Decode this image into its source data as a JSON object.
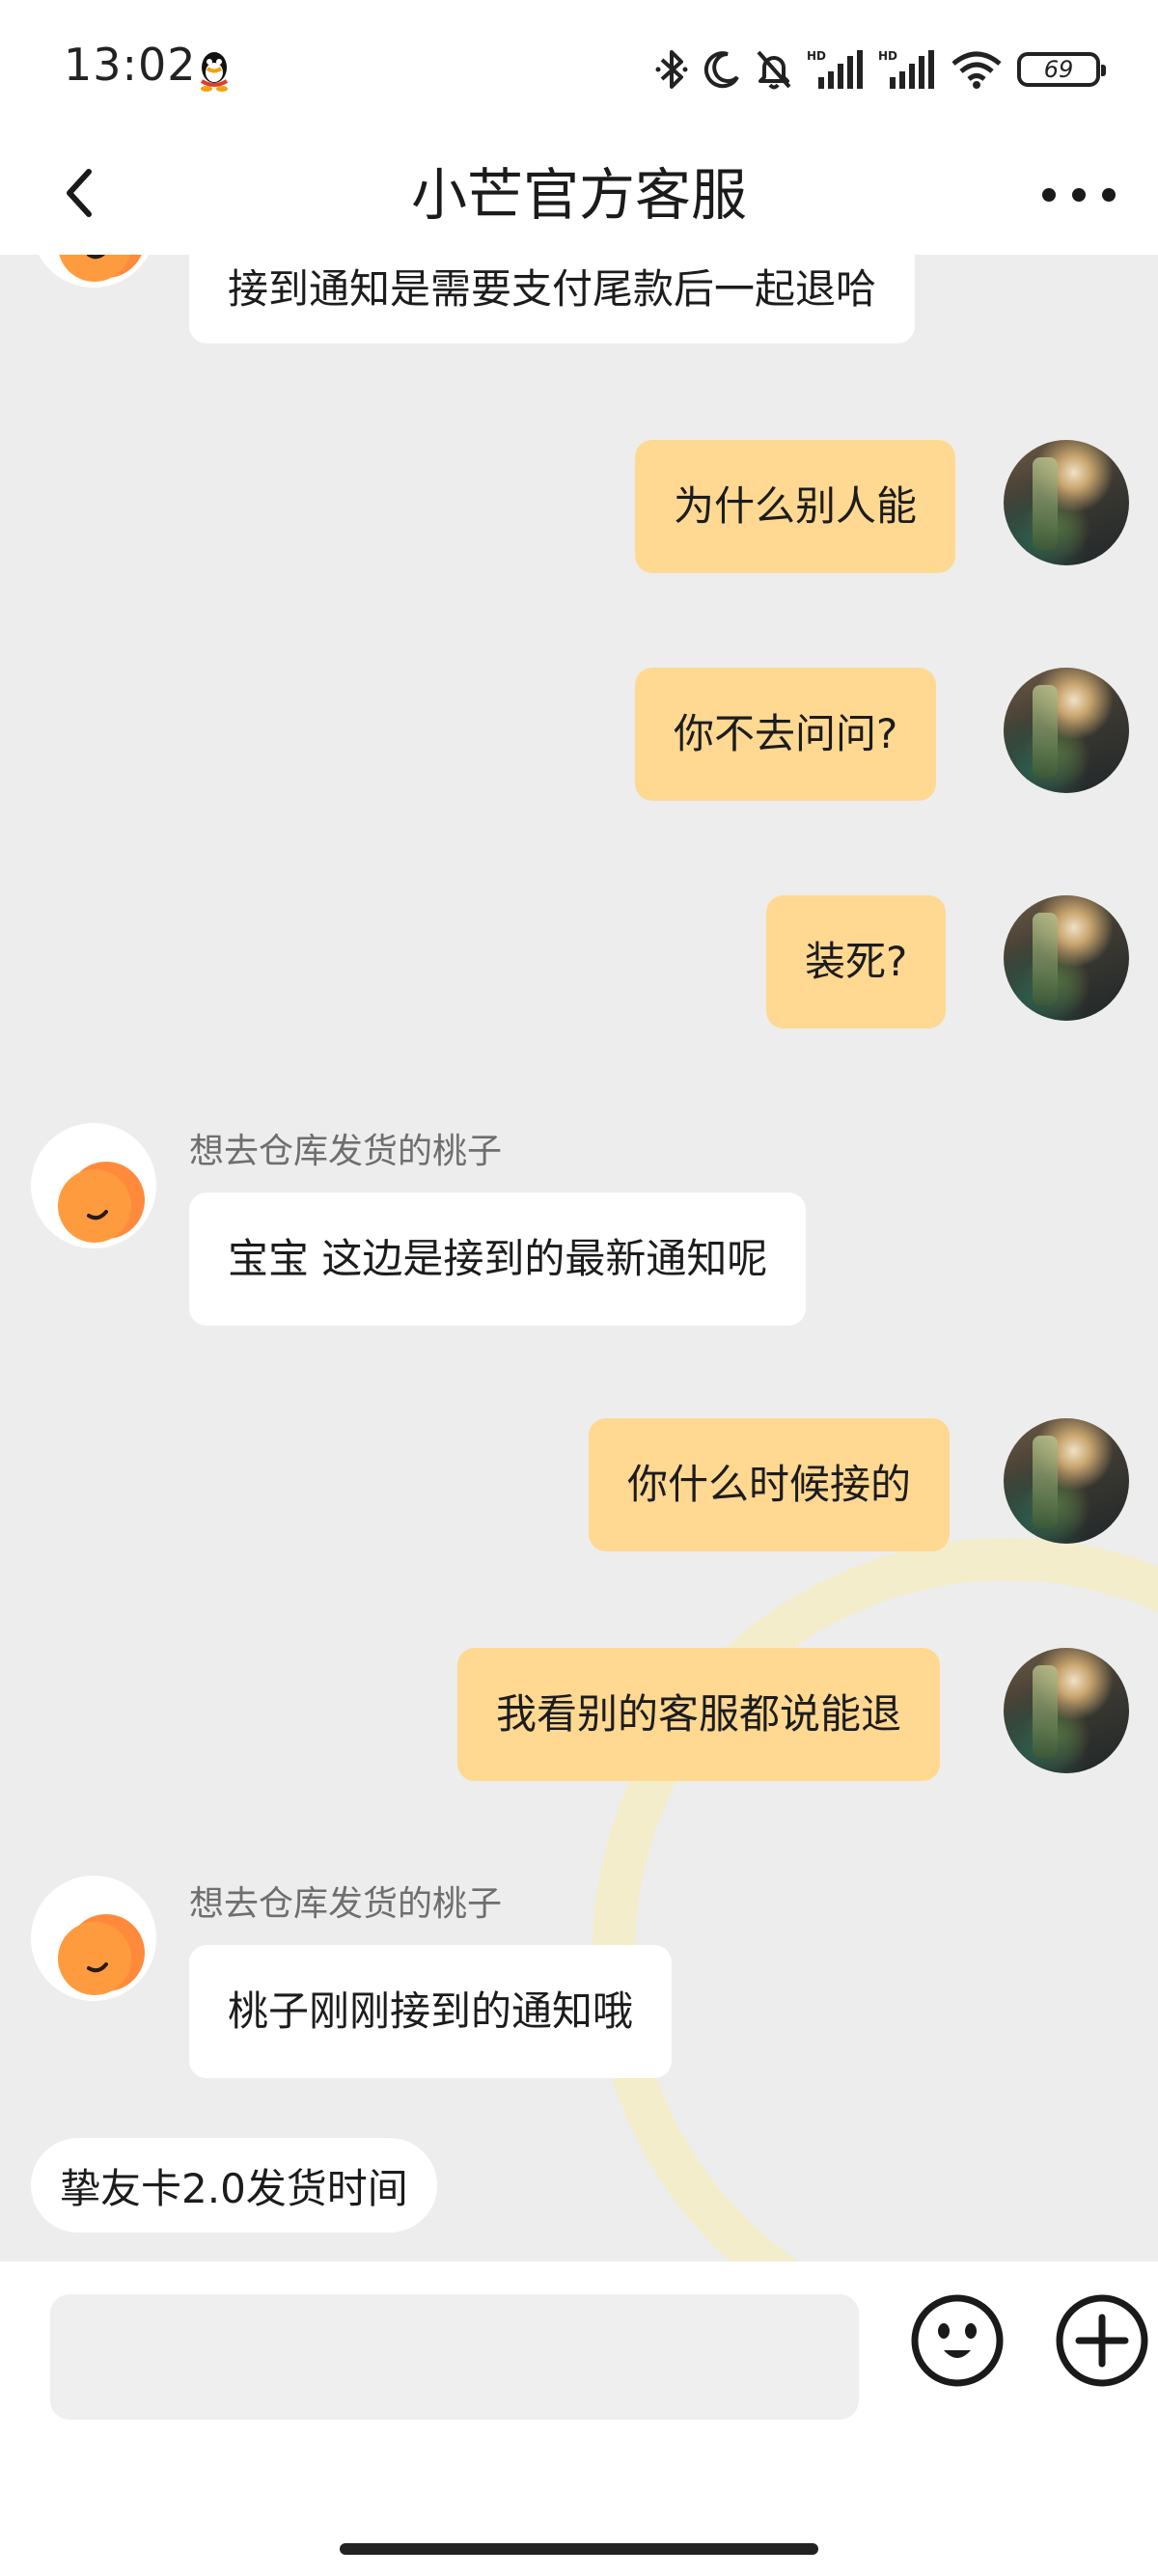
{
  "status_bar": {
    "time": "13:02",
    "battery_level": "69",
    "icons": [
      "qq-icon",
      "bluetooth-icon",
      "moon-icon",
      "bell-off-icon",
      "signal-hd-icon",
      "signal-hd-icon",
      "wifi-icon",
      "battery-icon"
    ]
  },
  "header": {
    "title": "小芒官方客服",
    "back_icon": "chevron-left-icon",
    "more_icon": "more-horizontal-icon"
  },
  "messages": [
    {
      "side": "in",
      "text": "接到通知是需要支付尾款后一起退哈"
    },
    {
      "side": "out",
      "text": "为什么别人能"
    },
    {
      "side": "out",
      "text": "你不去问问?"
    },
    {
      "side": "out",
      "text": "装死?"
    },
    {
      "side": "in",
      "sender": "想去仓库发货的桃子",
      "text": "宝宝 这边是接到的最新通知呢"
    },
    {
      "side": "out",
      "text": "你什么时候接的"
    },
    {
      "side": "out",
      "text": "我看别的客服都说能退"
    },
    {
      "side": "in",
      "sender": "想去仓库发货的桃子",
      "text": "桃子刚刚接到的通知哦"
    }
  ],
  "quick_reply": {
    "label": "挚友卡2.0发货时间"
  },
  "input_bar": {
    "value": "",
    "emoji_icon": "emoji-icon",
    "plus_icon": "plus-circle-icon"
  },
  "colors": {
    "outgoing_bubble": "#ffd892",
    "incoming_bubble": "#ffffff",
    "chat_background": "#ededed",
    "bot_avatar": "#ff8a3c"
  }
}
